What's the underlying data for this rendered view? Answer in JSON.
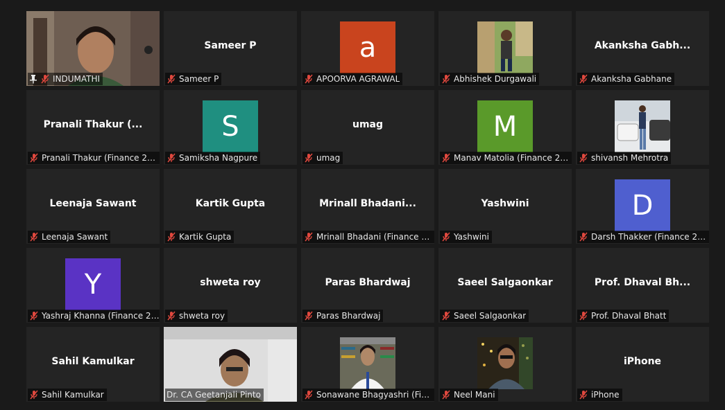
{
  "colors": {
    "active_border": "#c4d85a",
    "muted_icon": "#e0483e"
  },
  "tiles": [
    {
      "name": "INDUMATHI",
      "label": "INDUMATHI",
      "kind": "video",
      "pinned": true,
      "active": true
    },
    {
      "name": "Sameer P",
      "label": "Sameer P",
      "kind": "name"
    },
    {
      "name": "APOORVA AGRAWAL",
      "label": "APOORVA AGRAWAL",
      "kind": "avatar",
      "letter": "a",
      "color": "#c9441e"
    },
    {
      "name": "Abhishek Durgawali",
      "label": "Abhishek Durgawali",
      "kind": "photo"
    },
    {
      "name": "Akanksha  Gabh...",
      "label": "Akanksha Gabhane",
      "kind": "name"
    },
    {
      "name": "Pranali Thakur  (...",
      "label": "Pranali Thakur (Finance 21-...",
      "kind": "name"
    },
    {
      "name": "Samiksha Nagpure",
      "label": "Samiksha Nagpure",
      "kind": "avatar",
      "letter": "S",
      "color": "#1f8f80"
    },
    {
      "name": "umag",
      "label": "umag",
      "kind": "name"
    },
    {
      "name": "Manav Matolia",
      "label": "Manav Matolia (Finance 21...",
      "kind": "avatar",
      "letter": "M",
      "color": "#5a9a2a"
    },
    {
      "name": "shivansh Mehrotra",
      "label": "shivansh Mehrotra",
      "kind": "photo"
    },
    {
      "name": "Leenaja Sawant",
      "label": "Leenaja Sawant",
      "kind": "name"
    },
    {
      "name": "Kartik Gupta",
      "label": "Kartik Gupta",
      "kind": "name"
    },
    {
      "name": "Mrinall  Bhadani...",
      "label": "Mrinall Bhadani (Finance 2...",
      "kind": "name"
    },
    {
      "name": "Yashwini",
      "label": "Yashwini",
      "kind": "name"
    },
    {
      "name": "Darsh Thakker",
      "label": "Darsh Thakker (Finance 21-...",
      "kind": "avatar",
      "letter": "D",
      "color": "#4f5fcf"
    },
    {
      "name": "Yashraj Khanna",
      "label": "Yashraj Khanna (Finance 21...",
      "kind": "avatar",
      "letter": "Y",
      "color": "#5a33c4"
    },
    {
      "name": "shweta roy",
      "label": "shweta roy",
      "kind": "name"
    },
    {
      "name": "Paras Bhardwaj",
      "label": "Paras Bhardwaj",
      "kind": "name"
    },
    {
      "name": "Saeel Salgaonkar",
      "label": "Saeel Salgaonkar",
      "kind": "name"
    },
    {
      "name": "Prof. Dhaval Bh...",
      "label": "Prof. Dhaval Bhatt",
      "kind": "name"
    },
    {
      "name": "Sahil Kamulkar",
      "label": "Sahil Kamulkar",
      "kind": "name"
    },
    {
      "name": "Dr. CA Geetanjali Pinto",
      "label": "Dr. CA Geetanjali Pinto",
      "kind": "full",
      "nomic": true
    },
    {
      "name": "Sonawane Bhagyashri",
      "label": "Sonawane Bhagyashri (Fina...",
      "kind": "photo"
    },
    {
      "name": "Neel Mani",
      "label": "Neel Mani",
      "kind": "photo"
    },
    {
      "name": "iPhone",
      "label": "iPhone",
      "kind": "name"
    }
  ]
}
